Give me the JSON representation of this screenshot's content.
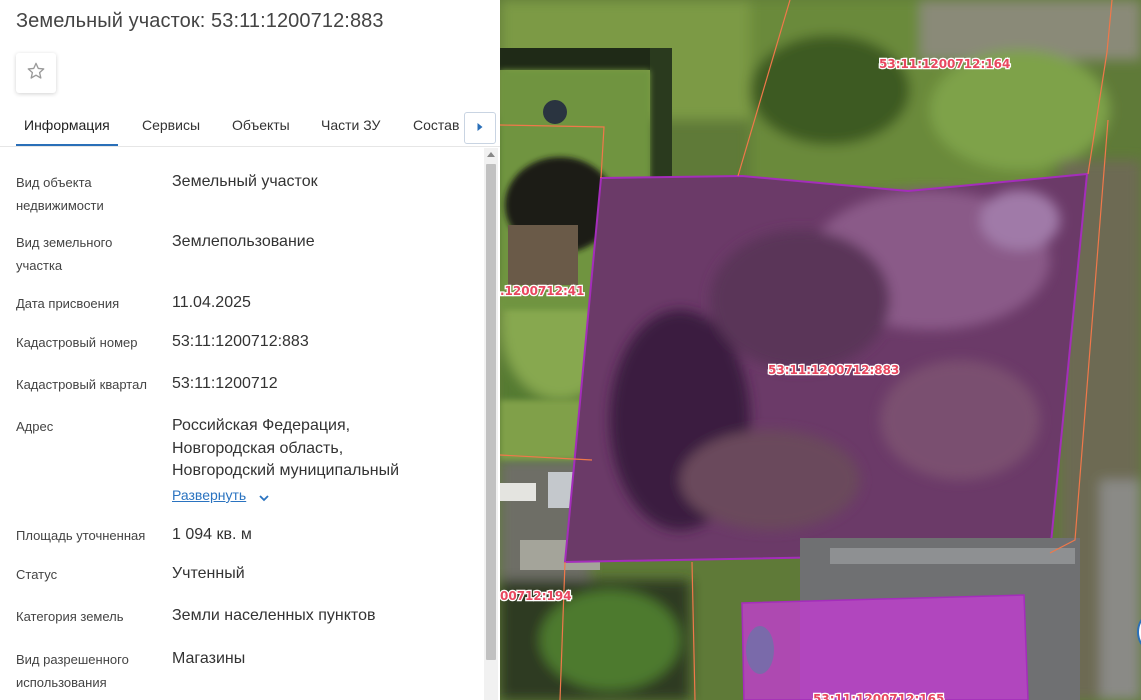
{
  "header": {
    "title": "Земельный участок: 53:11:1200712:883",
    "favorite_icon": "star-outline-icon"
  },
  "tabs": [
    {
      "label": "Информация",
      "active": true
    },
    {
      "label": "Сервисы",
      "active": false
    },
    {
      "label": "Объекты",
      "active": false
    },
    {
      "label": "Части ЗУ",
      "active": false
    },
    {
      "label": "Состав",
      "active": false
    }
  ],
  "tabs_next_icon": "caret-right-icon",
  "info": {
    "object_type": {
      "label": "Вид объекта недвижимости",
      "value": "Земельный участок"
    },
    "land_type": {
      "label": "Вид земельного участка",
      "value": "Землепользование"
    },
    "assign_date": {
      "label": "Дата присвоения",
      "value": "11.04.2025"
    },
    "cadastral_number": {
      "label": "Кадастровый номер",
      "value": "53:11:1200712:883"
    },
    "cadastral_quarter": {
      "label": "Кадастровый квартал",
      "value": "53:11:1200712"
    },
    "address": {
      "label": "Адрес",
      "lines": [
        "Российская Федерация,",
        "Новгородская область,",
        "Новгородский муниципальный"
      ],
      "expand_label": "Развернуть"
    },
    "area": {
      "label": "Площадь уточненная",
      "value": "1 094 кв. м"
    },
    "status": {
      "label": "Статус",
      "value": "Учтенный"
    },
    "land_category": {
      "label": "Категория земель",
      "value": "Земли населенных пунктов"
    },
    "permitted_use": {
      "label": "Вид разрешенного использования",
      "value": "Магазины"
    }
  },
  "map": {
    "labels": {
      "parcel_164": "53:11:1200712:164",
      "parcel_41": ".1200712:41",
      "parcel_883": "53:11:1200712:883",
      "parcel_194": "00712:194",
      "parcel_165": "53:11:1200712:165"
    },
    "colors": {
      "selected_outline": "#a42dbb",
      "neighbor_outline": "#f0784a",
      "parcel_label": "#e8475f",
      "building_fill": "#c43bd4"
    }
  },
  "colors": {
    "accent": "#2a6fb8",
    "link": "#2a73c0"
  }
}
